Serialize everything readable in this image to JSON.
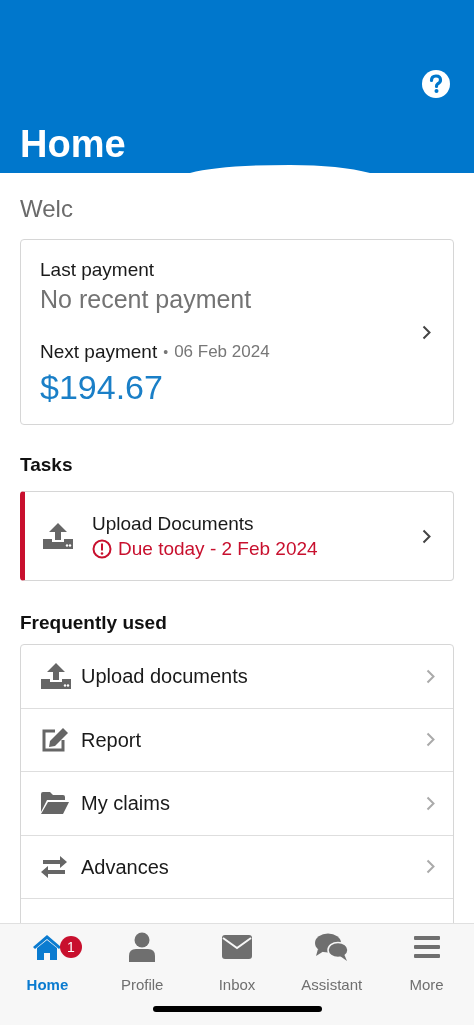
{
  "header": {
    "title": "Home"
  },
  "welcome": "Welc",
  "payment_card": {
    "last_label": "Last payment",
    "last_value": "No recent payment",
    "next_label": "Next payment",
    "separator": "•",
    "next_date": "06 Feb 2024",
    "amount": "$194.67"
  },
  "tasks": {
    "title": "Tasks",
    "items": [
      {
        "title": "Upload Documents",
        "due": "Due today - 2 Feb 2024",
        "overdue": true
      }
    ]
  },
  "frequently_used": {
    "title": "Frequently used",
    "items": [
      {
        "label": "Upload documents",
        "kind": "upload"
      },
      {
        "label": "Report",
        "kind": "edit"
      },
      {
        "label": "My claims",
        "kind": "folder"
      },
      {
        "label": "Advances",
        "kind": "exchange"
      }
    ]
  },
  "tab_bar": [
    {
      "label": "Home",
      "kind": "home",
      "selected": true,
      "badge": "1"
    },
    {
      "label": "Profile",
      "kind": "profile",
      "selected": false
    },
    {
      "label": "Inbox",
      "kind": "inbox",
      "selected": false
    },
    {
      "label": "Assistant",
      "kind": "chat",
      "selected": false
    },
    {
      "label": "More",
      "kind": "more",
      "selected": false
    }
  ]
}
